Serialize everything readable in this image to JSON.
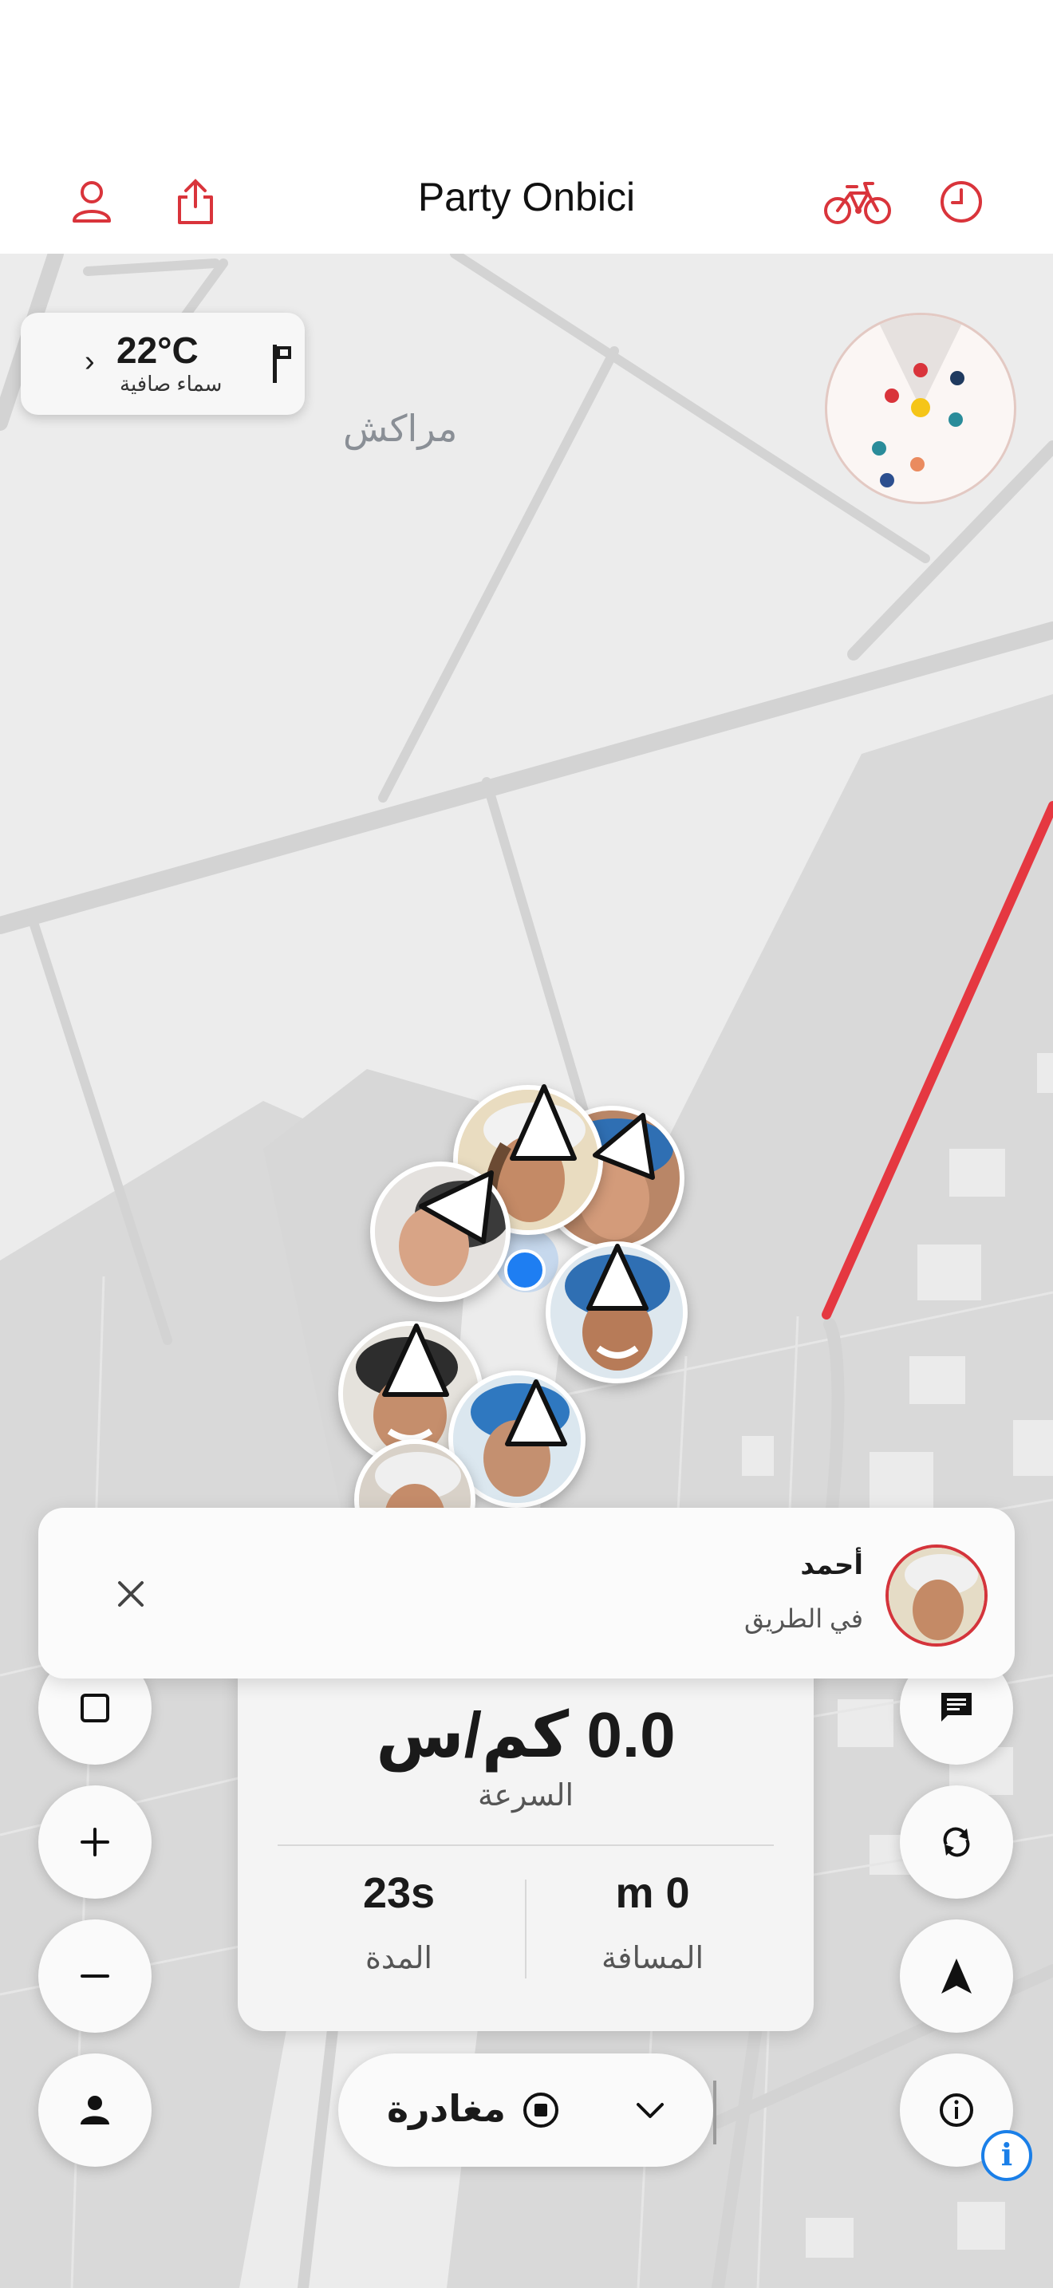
{
  "header": {
    "title": "Party Onbici",
    "icons": [
      "profile-icon",
      "share-icon",
      "bike-icon",
      "history-icon"
    ],
    "accent": "#d9343b"
  },
  "weather": {
    "temperature": "22°C",
    "condition": "سماء صافية",
    "icons": [
      "chevron-icon",
      "flag-icon"
    ]
  },
  "map": {
    "city_label": "مراكش",
    "route_color": "#e53841",
    "user_location_color": "#1e7ef2"
  },
  "notification": {
    "name": "أحمد",
    "status": "في الطريق",
    "icons": [
      "close-icon"
    ]
  },
  "stats": {
    "speed": "0.0 كم/س",
    "speed_label": "السرعة",
    "duration": "23s",
    "duration_label": "المدة",
    "distance": "m 0",
    "distance_label": "المسافة"
  },
  "controls": {
    "left": [
      "stop-square-icon",
      "zoom-in-icon",
      "zoom-out-icon",
      "person-icon"
    ],
    "right": [
      "chat-icon",
      "refresh-icon",
      "navigate-icon",
      "info-icon"
    ],
    "leave_label": "مغادرة",
    "leave_icons": [
      "stop-circle-icon",
      "chevron-down-icon"
    ],
    "info_badge": "i"
  }
}
